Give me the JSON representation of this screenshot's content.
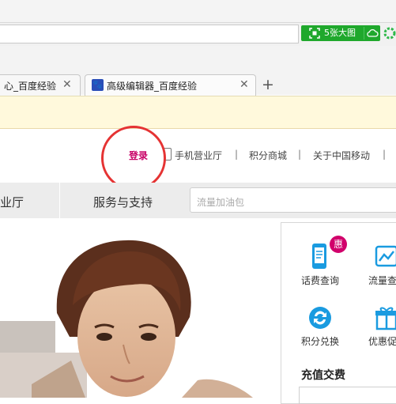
{
  "browser": {
    "bigpic_label": "5张大图",
    "tabs": [
      {
        "label": "心_百度经验",
        "close": "✕"
      },
      {
        "label": "高级编辑器_百度经验",
        "close": "✕"
      }
    ],
    "new_tab": "+"
  },
  "header": {
    "login": "登录",
    "links": [
      "手机营业厅",
      "积分商城",
      "关于中国移动"
    ],
    "separator": "|"
  },
  "nav": {
    "items": [
      "营业厅",
      "服务与支持"
    ],
    "search_placeholder": "流量加油包"
  },
  "panel": {
    "services": [
      "话费查询",
      "流量查",
      "积分兑换",
      "优惠促"
    ],
    "badge": "惠",
    "recharge_title": "充值交费"
  },
  "colors": {
    "accent_green": "#1fa82c",
    "login_magenta": "#c80066",
    "annotation_red": "#e53333",
    "service_blue": "#1a9be0"
  }
}
